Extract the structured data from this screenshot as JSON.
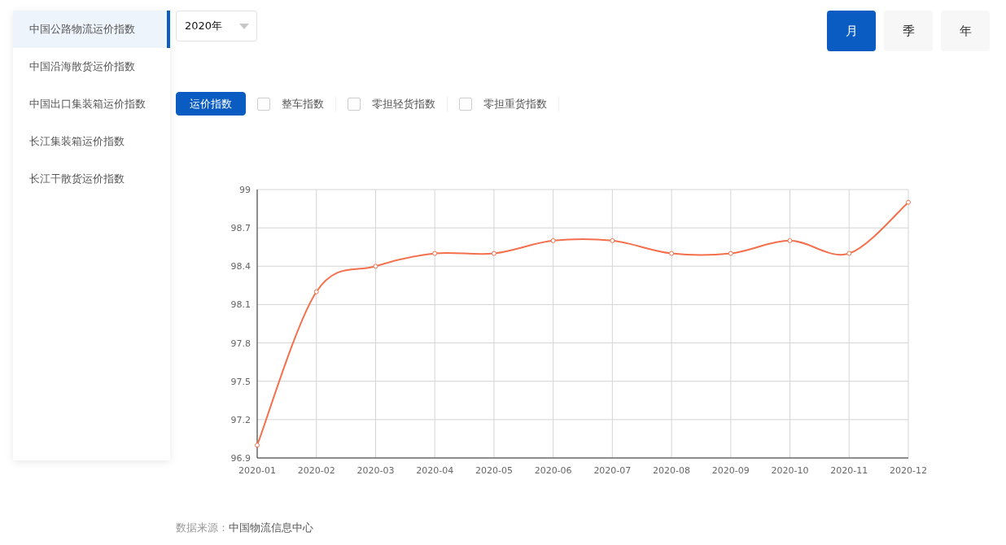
{
  "sidebar": {
    "items": [
      {
        "label": "中国公路物流运价指数",
        "selected": true
      },
      {
        "label": "中国沿海散货运价指数",
        "selected": false
      },
      {
        "label": "中国出口集装箱运价指数",
        "selected": false
      },
      {
        "label": "长江集装箱运价指数",
        "selected": false
      },
      {
        "label": "长江干散货运价指数",
        "selected": false
      }
    ]
  },
  "year_select": {
    "value": "2020年"
  },
  "period_buttons": [
    {
      "label": "月",
      "selected": true
    },
    {
      "label": "季",
      "selected": false
    },
    {
      "label": "年",
      "selected": false
    }
  ],
  "filters": [
    {
      "kind": "button",
      "label": "运价指数",
      "selected": true
    },
    {
      "kind": "checkbox",
      "label": "整车指数",
      "checked": false
    },
    {
      "kind": "checkbox",
      "label": "零担轻货指数",
      "checked": false
    },
    {
      "kind": "checkbox",
      "label": "零担重货指数",
      "checked": false
    }
  ],
  "chart": {
    "chart_data": {
      "type": "line",
      "categories": [
        "2020-01",
        "2020-02",
        "2020-03",
        "2020-04",
        "2020-05",
        "2020-06",
        "2020-07",
        "2020-08",
        "2020-09",
        "2020-10",
        "2020-11",
        "2020-12"
      ],
      "grid": true,
      "series": [
        {
          "color": "#f4704c",
          "marker": true,
          "values": [
            97.0,
            98.2,
            98.4,
            98.5,
            98.5,
            98.6,
            98.6,
            98.5,
            98.5,
            98.6,
            98.5,
            98.9
          ]
        }
      ],
      "ylim": [
        96.9,
        99
      ],
      "yticks": [
        {
          "value": 96.9,
          "label": "96.9"
        },
        {
          "value": 97.2,
          "label": "97.2"
        },
        {
          "value": 97.5,
          "label": "97.5"
        },
        {
          "value": 97.8,
          "label": "97.8"
        },
        {
          "value": 98.1,
          "label": "98.1"
        },
        {
          "value": 98.4,
          "label": "98.4"
        },
        {
          "value": 98.7,
          "label": "98.7"
        },
        {
          "value": 99,
          "label": "99"
        }
      ]
    }
  },
  "source": {
    "label": "数据来源：",
    "value": "中国物流信息中心"
  }
}
